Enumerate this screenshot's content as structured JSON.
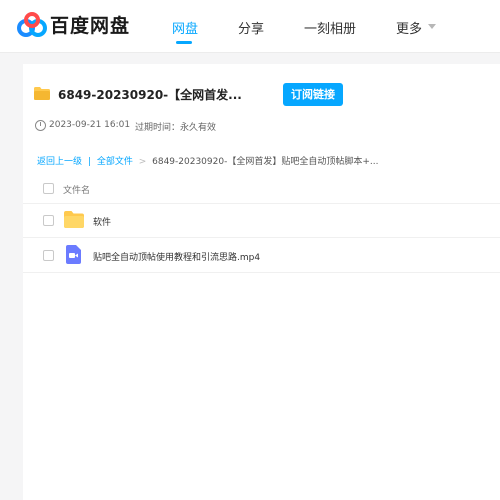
{
  "brand": {
    "name": "百度网盘",
    "colors": {
      "blue": "#06a7ff",
      "logo_red": "#ff4b4b",
      "logo_blue": "#1b8cff",
      "folder": "#ffc94d",
      "video": "#6b7bff"
    }
  },
  "nav": {
    "items": [
      {
        "label": "网盘",
        "active": true
      },
      {
        "label": "分享",
        "active": false
      },
      {
        "label": "一刻相册",
        "active": false
      },
      {
        "label": "更多",
        "active": false,
        "icon": "chevron-down-icon"
      }
    ]
  },
  "share": {
    "title": "6849-20230920-【全网首发...",
    "subscribe_label": "订阅链接",
    "date": "2023-09-21 16:01",
    "expire_label": "过期时间：",
    "expire_value": "永久有效"
  },
  "breadcrumb": {
    "back": "返回上一级",
    "divider": "|",
    "all_files": "全部文件",
    "separator": ">",
    "current": "6849-20230920-【全网首发】贴吧全自动顶帖脚本+..."
  },
  "file_list": {
    "column_name": "文件名",
    "rows": [
      {
        "name": "软件",
        "type": "folder",
        "icon": "folder-icon"
      },
      {
        "name": "贴吧全自动顶帖使用教程和引流思路.mp4",
        "type": "video",
        "icon": "video-file-icon"
      }
    ]
  }
}
